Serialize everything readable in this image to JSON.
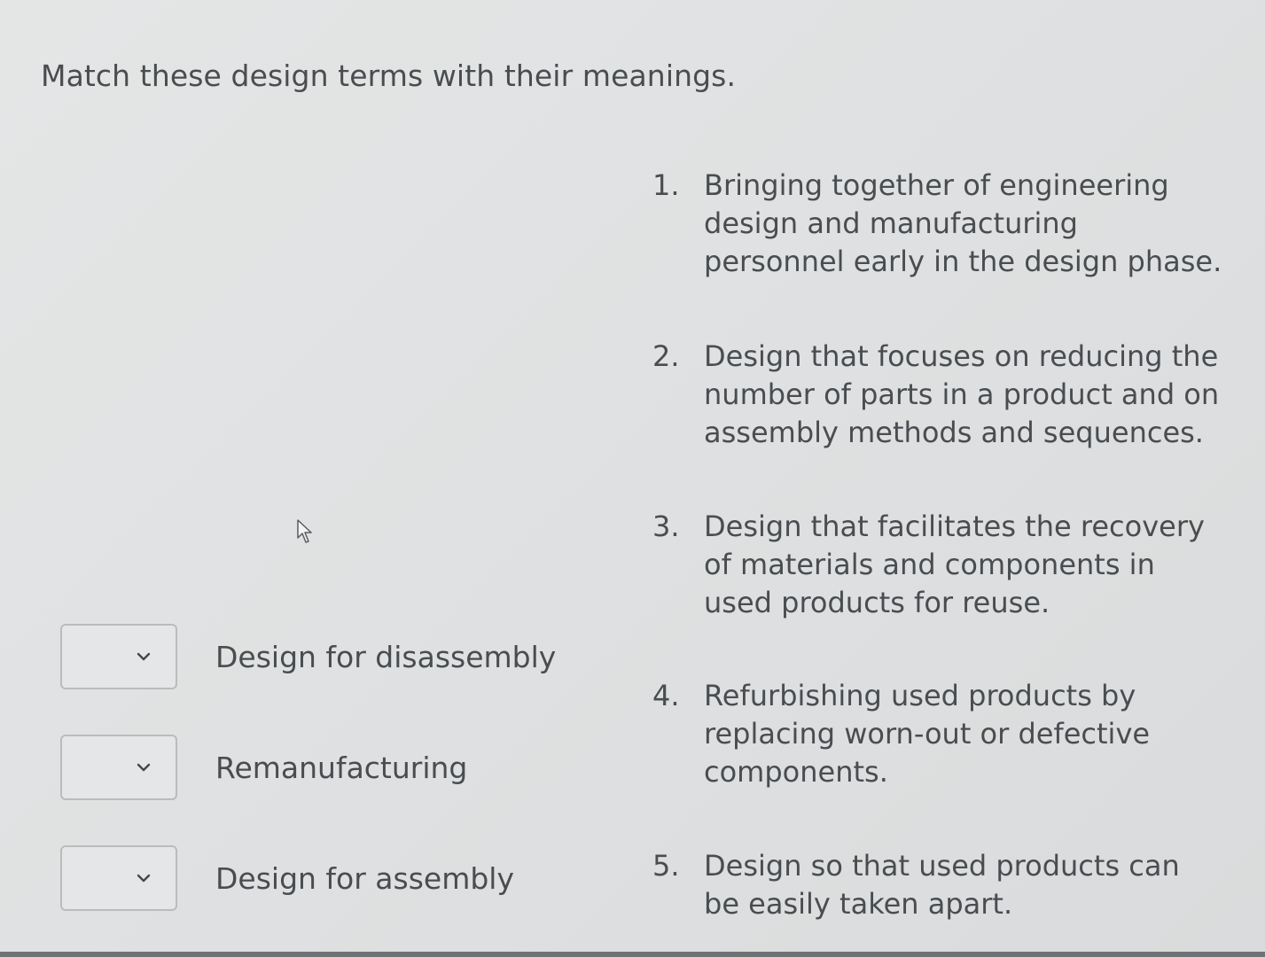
{
  "question": {
    "prompt": "Match these design terms with their meanings."
  },
  "answers": [
    {
      "number": "1.",
      "text": "Bringing together of engineering\ndesign and manufacturing\npersonnel early in the design phase."
    },
    {
      "number": "2.",
      "text": "Design that focuses on reducing the\nnumber of parts in a product and on\nassembly methods and sequences."
    },
    {
      "number": "3.",
      "text": "Design that facilitates the recovery\nof materials and components in\nused products for reuse."
    },
    {
      "number": "4.",
      "text": "Refurbishing used products by\nreplacing worn-out or defective\ncomponents."
    },
    {
      "number": "5.",
      "text": "Design so that used products can\nbe easily taken apart."
    }
  ],
  "terms": [
    {
      "label": "Design for disassembly",
      "selected": ""
    },
    {
      "label": "Remanufacturing",
      "selected": ""
    },
    {
      "label": "Design for assembly",
      "selected": ""
    }
  ],
  "icons": {
    "dropdown": "chevron-down-icon",
    "cursor": "mouse-pointer-icon"
  },
  "colors": {
    "background": "#e0e2e3",
    "text": "#4a4d50",
    "select_border": "#b9bcbe"
  }
}
